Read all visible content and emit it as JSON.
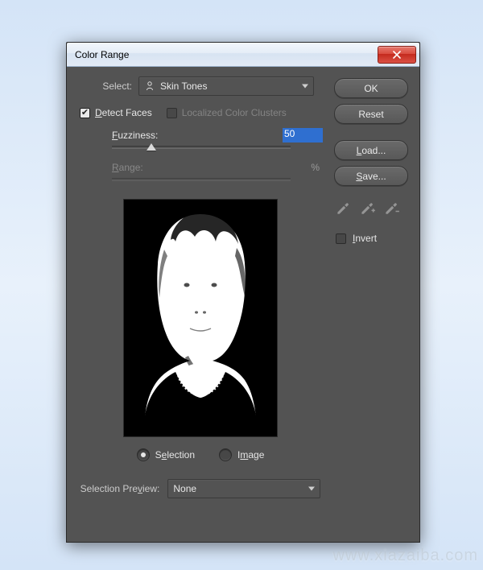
{
  "dialog": {
    "title": "Color Range",
    "select_label": "Select:",
    "select_value": "Skin Tones",
    "detect_faces": {
      "label": "Detect Faces",
      "checked": true,
      "underline_first": true
    },
    "localized": {
      "label": "Localized Color Clusters",
      "checked": false,
      "enabled": false
    },
    "fuzziness": {
      "label": "Fuzziness:",
      "value": "50",
      "underline_first": true
    },
    "range": {
      "label": "Range:",
      "value": "",
      "suffix": "%",
      "enabled": false,
      "underline_first": true
    },
    "view_mode": {
      "selection": {
        "label": "Selection",
        "checked": true,
        "underline_first_index": 1
      },
      "image": {
        "label": "Image",
        "checked": false,
        "underline_first_index": 1
      }
    },
    "selection_preview": {
      "label": "Selection Preview:",
      "value": "None",
      "underline_index": 10
    },
    "buttons": {
      "ok": "OK",
      "reset": "Reset",
      "load": "Load...",
      "save": "Save..."
    },
    "invert": {
      "label": "Invert",
      "checked": false,
      "underline_first": true
    },
    "eyedroppers": [
      "eyedropper",
      "eyedropper-add",
      "eyedropper-subtract"
    ]
  },
  "watermark": "www.xiazaiba.com"
}
